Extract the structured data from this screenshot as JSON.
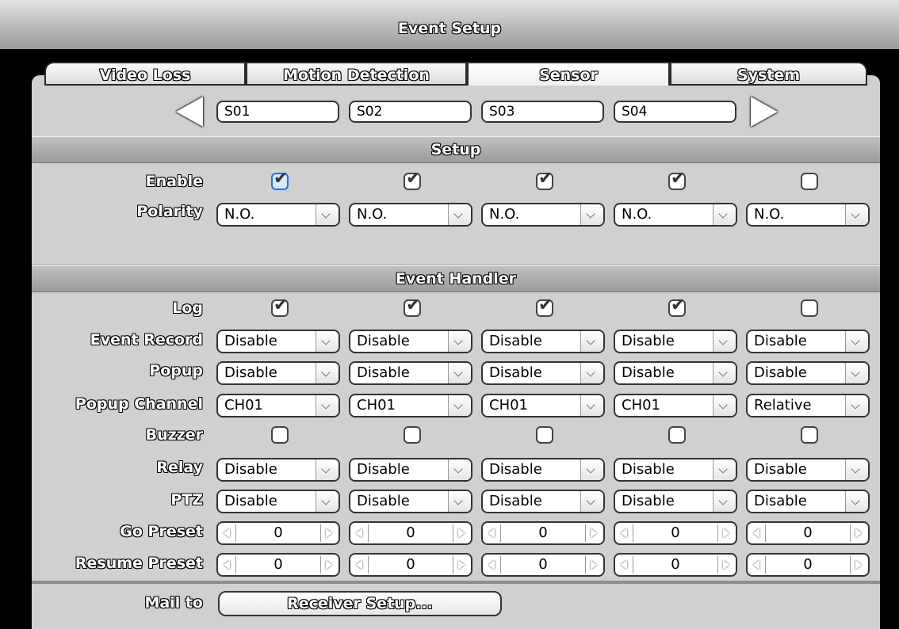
{
  "window": {
    "title": "Event Setup"
  },
  "tabs": [
    {
      "label": "Video Loss",
      "active": false
    },
    {
      "label": "Motion Detection",
      "active": false
    },
    {
      "label": "Sensor",
      "active": true
    },
    {
      "label": "System",
      "active": false
    }
  ],
  "channels": [
    "S01",
    "S02",
    "S03",
    "S04"
  ],
  "sections": {
    "setup": "Setup",
    "event_handler": "Event Handler"
  },
  "labels": {
    "enable": "Enable",
    "polarity": "Polarity",
    "log": "Log",
    "event_record": "Event Record",
    "popup": "Popup",
    "popup_channel": "Popup Channel",
    "buzzer": "Buzzer",
    "relay": "Relay",
    "ptz": "PTZ",
    "go_preset": "Go Preset",
    "resume_preset": "Resume Preset",
    "mail_to": "Mail to"
  },
  "columns": [
    {
      "enable": true,
      "polarity": "N.O.",
      "log": true,
      "event_record": "Disable",
      "popup": "Disable",
      "popup_channel": "CH01",
      "buzzer": false,
      "relay": "Disable",
      "ptz": "Disable",
      "go_preset": "0",
      "resume_preset": "0"
    },
    {
      "enable": true,
      "polarity": "N.O.",
      "log": true,
      "event_record": "Disable",
      "popup": "Disable",
      "popup_channel": "CH01",
      "buzzer": false,
      "relay": "Disable",
      "ptz": "Disable",
      "go_preset": "0",
      "resume_preset": "0"
    },
    {
      "enable": true,
      "polarity": "N.O.",
      "log": true,
      "event_record": "Disable",
      "popup": "Disable",
      "popup_channel": "CH01",
      "buzzer": false,
      "relay": "Disable",
      "ptz": "Disable",
      "go_preset": "0",
      "resume_preset": "0"
    },
    {
      "enable": true,
      "polarity": "N.O.",
      "log": true,
      "event_record": "Disable",
      "popup": "Disable",
      "popup_channel": "CH01",
      "buzzer": false,
      "relay": "Disable",
      "ptz": "Disable",
      "go_preset": "0",
      "resume_preset": "0"
    },
    {
      "enable": false,
      "polarity": "N.O.",
      "log": false,
      "event_record": "Disable",
      "popup": "Disable",
      "popup_channel": "Relative",
      "buzzer": false,
      "relay": "Disable",
      "ptz": "Disable",
      "go_preset": "0",
      "resume_preset": "0"
    }
  ],
  "receiver_button": "Receiver Setup..."
}
